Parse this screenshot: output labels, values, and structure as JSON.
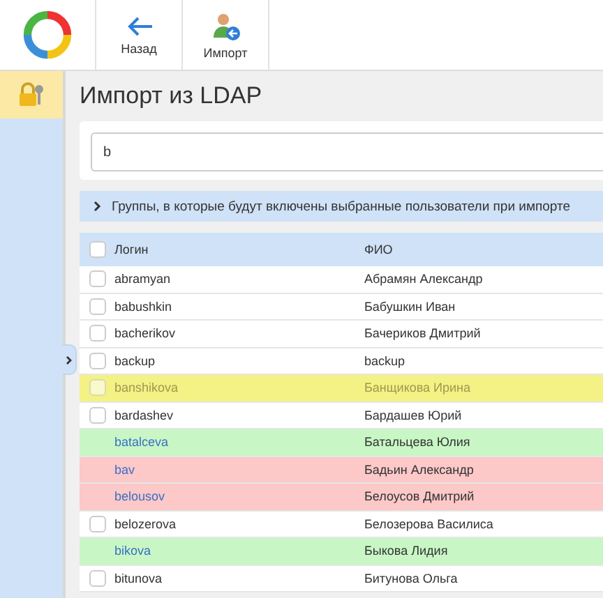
{
  "toolbar": {
    "buttons": [
      {
        "label": "Назад",
        "kind": "back"
      },
      {
        "label": "Импорт",
        "kind": "import"
      }
    ]
  },
  "page": {
    "title": "Импорт из LDAP"
  },
  "search": {
    "value": "b"
  },
  "groups_bar": {
    "label": "Группы, в которые будут включены выбранные пользователи при импорте",
    "expanded": false
  },
  "table": {
    "columns": [
      "Логин",
      "ФИО"
    ],
    "header_checked": false,
    "rows": [
      {
        "login": "abramyan",
        "name": "Абрамян Александр",
        "kind": "normal",
        "checked": false
      },
      {
        "login": "babushkin",
        "name": "Бабушкин Иван",
        "kind": "normal",
        "checked": false
      },
      {
        "login": "bacherikov",
        "name": "Бачериков Дмитрий",
        "kind": "normal",
        "checked": false
      },
      {
        "login": "backup",
        "name": "backup",
        "kind": "normal",
        "checked": false
      },
      {
        "login": "banshikova",
        "name": "Банщикова Ирина",
        "kind": "disabled",
        "checked": false
      },
      {
        "login": "bardashev",
        "name": "Бардашев Юрий",
        "kind": "normal",
        "checked": false
      },
      {
        "login": "batalceva",
        "name": "Батальцева Юлия",
        "kind": "imported"
      },
      {
        "login": "bav",
        "name": "Бадьин Александр",
        "kind": "conflict"
      },
      {
        "login": "belousov",
        "name": "Белоусов Дмитрий",
        "kind": "conflict"
      },
      {
        "login": "belozerova",
        "name": "Белозерова Василиса",
        "kind": "normal",
        "checked": false
      },
      {
        "login": "bikova",
        "name": "Быкова Лидия",
        "kind": "imported"
      },
      {
        "login": "bitunova",
        "name": "Битунова Ольга",
        "kind": "normal",
        "checked": false
      }
    ]
  }
}
